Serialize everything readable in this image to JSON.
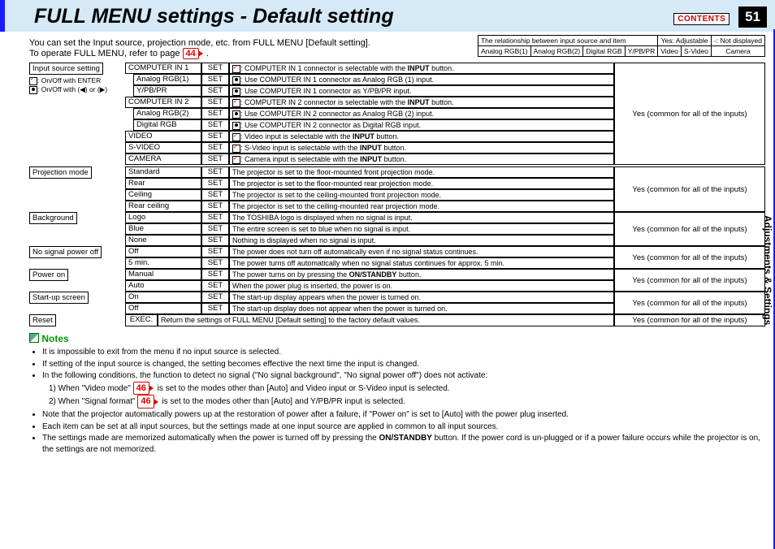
{
  "header": {
    "title": "FULL MENU settings - Default setting",
    "contents_btn": "CONTENTS",
    "page_num": "51"
  },
  "side_tab": "Adjustments &\nSettings",
  "intro": {
    "line1": "You can set the Input source, projection mode, etc. from FULL MENU [Default setting].",
    "line2a": "To operate FULL MENU, refer to page ",
    "ref1": "44",
    "line2b": "."
  },
  "rel_header": {
    "text": "The relationship between input source and item",
    "yes": "Yes: Adjustable",
    "no": "-: Not displayed",
    "cols": [
      "Analog RGB(1)",
      "Analog RGB(2)",
      "Digital RGB",
      "Y/PB/PR",
      "Video",
      "S-Video",
      "Camera"
    ]
  },
  "legend": {
    "l1": ": On/Off with ENTER",
    "l2": ": On/Off with (◀) or (▶)"
  },
  "cat": {
    "input": "Input source setting",
    "proj": "Projection mode",
    "bg": "Background",
    "nosig": "No signal power off",
    "pon": "Power on",
    "start": "Start-up screen",
    "reset": "Reset"
  },
  "set": "SET",
  "exec": "EXEC.",
  "yes_common": "Yes (common for all of the inputs)",
  "input_rows": [
    {
      "n": "COMPUTER IN 1",
      "d": ": COMPUTER IN 1 connector is selectable with the INPUT button.",
      "ic": "r"
    },
    {
      "n": "Analog RGB(1)",
      "d": ": Use COMPUTER IN 1 connector as Analog RGB (1) input.",
      "ic": "b",
      "in": 1
    },
    {
      "n": "Y/PB/PR",
      "d": ": Use COMPUTER IN 1 connector as Y/PB/PR input.",
      "ic": "b",
      "in": 1
    },
    {
      "n": "COMPUTER IN 2",
      "d": ": COMPUTER IN 2 connector is selectable with the INPUT button.",
      "ic": "r"
    },
    {
      "n": "Analog RGB(2)",
      "d": ": Use COMPUTER IN 2 connector as Analog RGB (2) input.",
      "ic": "b",
      "in": 1
    },
    {
      "n": "Digital RGB",
      "d": ": Use COMPUTER IN 2 connector as Digital RGB input.",
      "ic": "b",
      "in": 1
    },
    {
      "n": "VIDEO",
      "d": ": Video input is selectable with the INPUT button.",
      "ic": "r"
    },
    {
      "n": "S-VIDEO",
      "d": ": S-Video input is selectable with the INPUT button.",
      "ic": "r"
    },
    {
      "n": "CAMERA",
      "d": ": Camera input is selectable with the INPUT button.",
      "ic": "r"
    }
  ],
  "proj_rows": [
    {
      "n": "Standard",
      "d": "The projector is set to the floor-mounted front projection mode."
    },
    {
      "n": "Rear",
      "d": "The projector is set to the floor-mounted rear projection mode."
    },
    {
      "n": "Ceiling",
      "d": "The projector is set to the ceiling-mounted front projection mode."
    },
    {
      "n": "Rear ceiling",
      "d": "The projector is set to the ceiling-mounted rear projection mode."
    }
  ],
  "bg_rows": [
    {
      "n": "Logo",
      "d": "The TOSHIBA logo is displayed when no signal is input."
    },
    {
      "n": "Blue",
      "d": "The entire screen is set to blue when no signal is input."
    },
    {
      "n": "None",
      "d": "Nothing is displayed when no signal is input."
    }
  ],
  "nosig_rows": [
    {
      "n": "Off",
      "d": "The power does not turn off automatically even if no signal status continues."
    },
    {
      "n": "5 min.",
      "d": "The power turns off automatically when no signal status continues for approx. 5 min."
    }
  ],
  "pon_rows": [
    {
      "n": "Manual",
      "d": "The power turns on by pressing the ON/STANDBY button."
    },
    {
      "n": "Auto",
      "d": "When the power plug is inserted, the power is on."
    }
  ],
  "start_rows": [
    {
      "n": "On",
      "d": "The start-up display appears when the power is turned on."
    },
    {
      "n": "Off",
      "d": "The start-up display does not appear when the power is turned on."
    }
  ],
  "reset_row": {
    "d": "Return the settings of FULL MENU [Default setting] to the factory default values."
  },
  "notes": {
    "title": "Notes",
    "items": [
      "It is impossible to exit from the menu if no input source is selected.",
      "If setting of the input source is changed, the setting becomes effective the next time the input is changed.",
      "In the following conditions, the function to detect no signal (\"No signal background\", \"No signal power off\") does not activate:",
      "Note that the projector automatically powers up at the restoration of power after a failure, if \"Power on\" is set to [Auto] with the power plug inserted.",
      "Each item can be set at all input sources, but the settings made at one input source are applied in common to all input sources.",
      "The settings made are memorized automatically when the power is turned off by pressing the ON/STANDBY button. If the power cord is un-plugged or if a power failure occurs while the projector is on, the settings are not memorized."
    ],
    "sub1a": "1) When \"Video mode\" ",
    "sub1r": "46",
    "sub1b": " is set to the modes other than [Auto] and Video input or S-Video input is selected.",
    "sub2a": "2) When \"Signal format\" ",
    "sub2r": "46",
    "sub2b": " is set to the modes other than [Auto] and Y/PB/PR input is selected."
  }
}
